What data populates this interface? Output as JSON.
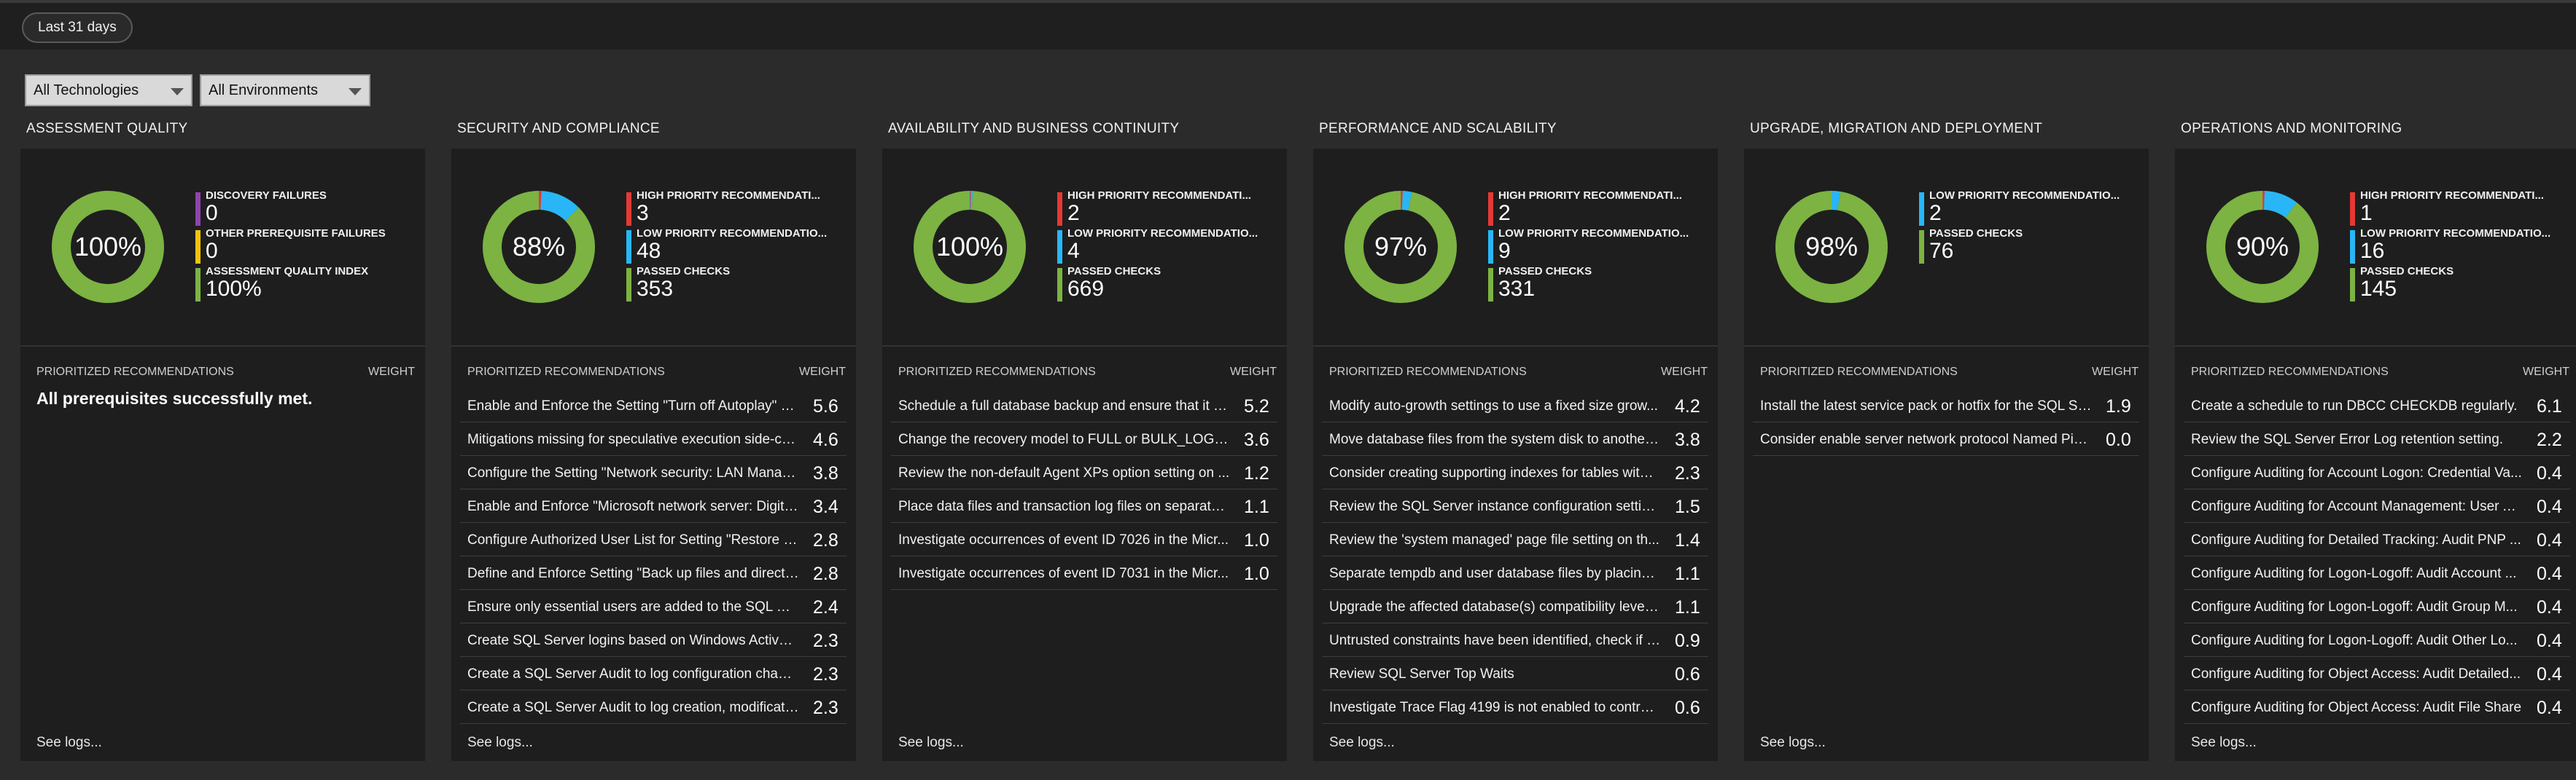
{
  "time_filter": "Last 31 days",
  "filters": {
    "technology": "All Technologies",
    "environment": "All Environments"
  },
  "colors": {
    "passed": "#7cb342",
    "low": "#29b6f6",
    "high": "#e53935",
    "discovery": "#8e44ad",
    "prereq": "#f4c20d"
  },
  "columns": [
    {
      "title": "ASSESSMENT QUALITY",
      "percent": "100%",
      "segments": [
        {
          "label": "DISCOVERY FAILURES",
          "value": "0",
          "color": "#8e44ad",
          "count": 0
        },
        {
          "label": "OTHER PREREQUISITE FAILURES",
          "value": "0",
          "color": "#f4c20d",
          "count": 0
        },
        {
          "label": "ASSESSMENT QUALITY INDEX",
          "value": "100%",
          "color": "#7cb342",
          "count": 100
        }
      ],
      "rec_header": "PRIORITIZED RECOMMENDATIONS",
      "weight_header": "WEIGHT",
      "empty_message": "All prerequisites successfully met.",
      "recommendations": [],
      "see_logs": "See logs..."
    },
    {
      "title": "SECURITY AND COMPLIANCE",
      "percent": "88%",
      "segments": [
        {
          "label": "HIGH PRIORITY RECOMMENDATI...",
          "value": "3",
          "color": "#e53935",
          "count": 3
        },
        {
          "label": "LOW PRIORITY RECOMMENDATIO...",
          "value": "48",
          "color": "#29b6f6",
          "count": 48
        },
        {
          "label": "PASSED CHECKS",
          "value": "353",
          "color": "#7cb342",
          "count": 353
        }
      ],
      "rec_header": "PRIORITIZED RECOMMENDATIONS",
      "weight_header": "WEIGHT",
      "empty_message": "",
      "recommendations": [
        {
          "text": "Enable and Enforce the Setting \"Turn off Autoplay\" vi...",
          "weight": "5.6"
        },
        {
          "text": "Mitigations missing for speculative execution side-ch...",
          "weight": "4.6"
        },
        {
          "text": "Configure the Setting \"Network security: LAN Manag...",
          "weight": "3.8"
        },
        {
          "text": "Enable and Enforce \"Microsoft network server: Digita...",
          "weight": "3.4"
        },
        {
          "text": "Configure Authorized User List for Setting \"Restore fi...",
          "weight": "2.8"
        },
        {
          "text": "Define and Enforce Setting \"Back up files and directo...",
          "weight": "2.8"
        },
        {
          "text": "Ensure only essential users are added to the SQL Ser...",
          "weight": "2.4"
        },
        {
          "text": "Create SQL Server logins based on Windows Active ...",
          "weight": "2.3"
        },
        {
          "text": "Create a SQL Server Audit to log configuration chang...",
          "weight": "2.3"
        },
        {
          "text": "Create a SQL Server Audit to log creation, modificati...",
          "weight": "2.3"
        }
      ],
      "see_logs": "See logs..."
    },
    {
      "title": "AVAILABILITY AND BUSINESS CONTINUITY",
      "percent": "100%",
      "segments": [
        {
          "label": "HIGH PRIORITY RECOMMENDATI...",
          "value": "2",
          "color": "#e53935",
          "count": 2
        },
        {
          "label": "LOW PRIORITY RECOMMENDATIO...",
          "value": "4",
          "color": "#29b6f6",
          "count": 4
        },
        {
          "label": "PASSED CHECKS",
          "value": "669",
          "color": "#7cb342",
          "count": 669
        }
      ],
      "rec_header": "PRIORITIZED RECOMMENDATIONS",
      "weight_header": "WEIGHT",
      "empty_message": "",
      "recommendations": [
        {
          "text": "Schedule a full database backup and ensure that it h...",
          "weight": "5.2"
        },
        {
          "text": "Change the recovery model to FULL or BULK_LOGGED.",
          "weight": "3.6"
        },
        {
          "text": "Review the non-default Agent XPs option setting on ...",
          "weight": "1.2"
        },
        {
          "text": "Place data files and transaction log files on separate ...",
          "weight": "1.1"
        },
        {
          "text": "Investigate occurrences of event ID 7026 in the Micr...",
          "weight": "1.0"
        },
        {
          "text": "Investigate occurrences of event ID 7031 in the Micr...",
          "weight": "1.0"
        }
      ],
      "see_logs": "See logs..."
    },
    {
      "title": "PERFORMANCE AND SCALABILITY",
      "percent": "97%",
      "segments": [
        {
          "label": "HIGH PRIORITY RECOMMENDATI...",
          "value": "2",
          "color": "#e53935",
          "count": 2
        },
        {
          "label": "LOW PRIORITY RECOMMENDATIO...",
          "value": "9",
          "color": "#29b6f6",
          "count": 9
        },
        {
          "label": "PASSED CHECKS",
          "value": "331",
          "color": "#7cb342",
          "count": 331
        }
      ],
      "rec_header": "PRIORITIZED RECOMMENDATIONS",
      "weight_header": "WEIGHT",
      "empty_message": "",
      "recommendations": [
        {
          "text": "Modify auto-growth settings to use a fixed size grow...",
          "weight": "4.2"
        },
        {
          "text": "Move database files from the system disk to another ...",
          "weight": "3.8"
        },
        {
          "text": "Consider creating supporting indexes for tables with ...",
          "weight": "2.3"
        },
        {
          "text": "Review the SQL Server instance configuration setting...",
          "weight": "1.5"
        },
        {
          "text": "Review the 'system managed' page file setting on th...",
          "weight": "1.4"
        },
        {
          "text": "Separate tempdb and user database files by placing ...",
          "weight": "1.1"
        },
        {
          "text": "Upgrade the affected database(s) compatibility level ...",
          "weight": "1.1"
        },
        {
          "text": "Untrusted constraints have been identified, check if y...",
          "weight": "0.9"
        },
        {
          "text": "Review SQL Server Top Waits",
          "weight": "0.6"
        },
        {
          "text": "Investigate Trace Flag 4199 is not enabled to control ...",
          "weight": "0.6"
        }
      ],
      "see_logs": "See logs..."
    },
    {
      "title": "UPGRADE, MIGRATION AND DEPLOYMENT",
      "percent": "98%",
      "segments": [
        {
          "label": "LOW PRIORITY RECOMMENDATIO...",
          "value": "2",
          "color": "#29b6f6",
          "count": 2
        },
        {
          "label": "PASSED CHECKS",
          "value": "76",
          "color": "#7cb342",
          "count": 76
        }
      ],
      "rec_header": "PRIORITIZED RECOMMENDATIONS",
      "weight_header": "WEIGHT",
      "empty_message": "",
      "recommendations": [
        {
          "text": "Install the latest service pack or hotfix for the SQL Se...",
          "weight": "1.9"
        },
        {
          "text": "Consider enable server network protocol Named Pip...",
          "weight": "0.0"
        }
      ],
      "see_logs": "See logs..."
    },
    {
      "title": "OPERATIONS AND MONITORING",
      "percent": "90%",
      "segments": [
        {
          "label": "HIGH PRIORITY RECOMMENDATI...",
          "value": "1",
          "color": "#e53935",
          "count": 1
        },
        {
          "label": "LOW PRIORITY RECOMMENDATIO...",
          "value": "16",
          "color": "#29b6f6",
          "count": 16
        },
        {
          "label": "PASSED CHECKS",
          "value": "145",
          "color": "#7cb342",
          "count": 145
        }
      ],
      "rec_header": "PRIORITIZED RECOMMENDATIONS",
      "weight_header": "WEIGHT",
      "empty_message": "",
      "recommendations": [
        {
          "text": "Create a schedule to run DBCC CHECKDB regularly.",
          "weight": "6.1"
        },
        {
          "text": "Review the SQL Server Error Log retention setting.",
          "weight": "2.2"
        },
        {
          "text": "Configure Auditing for Account Logon: Credential Va...",
          "weight": "0.4"
        },
        {
          "text": "Configure Auditing for Account Management: User A...",
          "weight": "0.4"
        },
        {
          "text": "Configure Auditing for Detailed Tracking: Audit PNP ...",
          "weight": "0.4"
        },
        {
          "text": "Configure Auditing for Logon-Logoff: Audit Account ...",
          "weight": "0.4"
        },
        {
          "text": "Configure Auditing for Logon-Logoff: Audit Group M...",
          "weight": "0.4"
        },
        {
          "text": "Configure Auditing for Logon-Logoff: Audit Other Lo...",
          "weight": "0.4"
        },
        {
          "text": "Configure Auditing for Object Access: Audit Detailed...",
          "weight": "0.4"
        },
        {
          "text": "Configure Auditing for Object Access: Audit File Share",
          "weight": "0.4"
        }
      ],
      "see_logs": "See logs..."
    }
  ]
}
